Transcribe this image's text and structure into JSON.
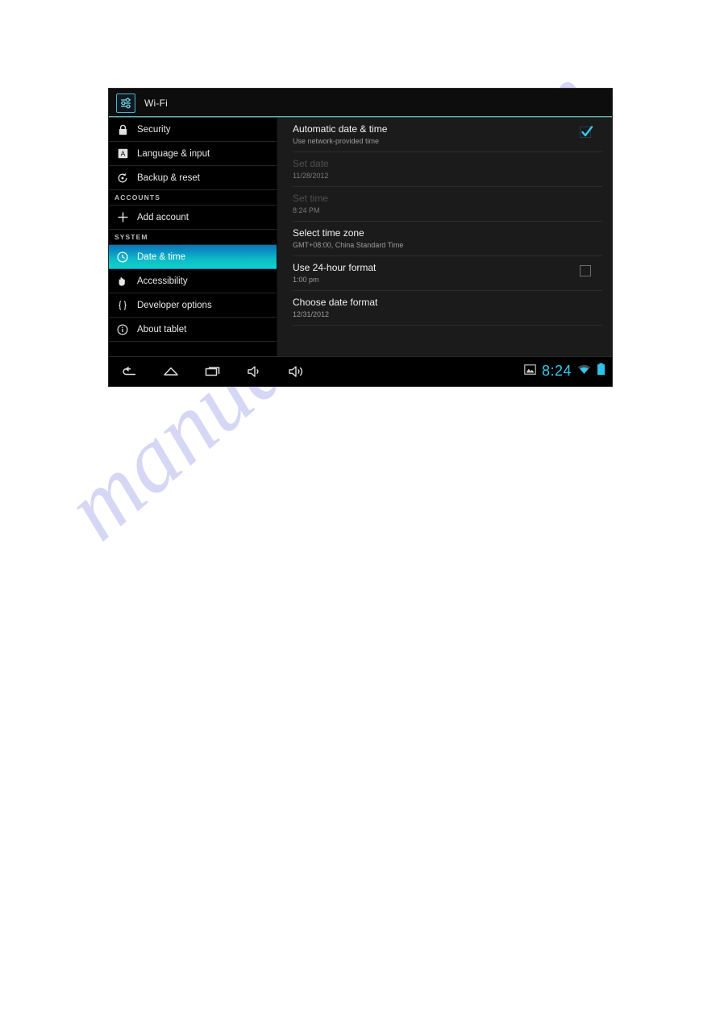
{
  "page": {
    "watermark": "manualshive.com"
  },
  "titlebar": {
    "icon": "settings-sliders-icon",
    "label": "Wi-Fi"
  },
  "sidebar": {
    "items": [
      {
        "type": "item",
        "icon": "lock-icon",
        "label": "Security",
        "selected": false
      },
      {
        "type": "item",
        "icon": "language-a-icon",
        "label": "Language & input",
        "selected": false
      },
      {
        "type": "item",
        "icon": "backup-reset-icon",
        "label": "Backup & reset",
        "selected": false
      },
      {
        "type": "section",
        "label": "ACCOUNTS"
      },
      {
        "type": "item",
        "icon": "plus-icon",
        "label": "Add account",
        "selected": false
      },
      {
        "type": "section",
        "label": "SYSTEM"
      },
      {
        "type": "item",
        "icon": "clock-icon",
        "label": "Date & time",
        "selected": true
      },
      {
        "type": "item",
        "icon": "hand-accessibility-icon",
        "label": "Accessibility",
        "selected": false
      },
      {
        "type": "item",
        "icon": "curly-braces-icon",
        "label": "Developer options",
        "selected": false
      },
      {
        "type": "item",
        "icon": "info-circle-icon",
        "label": "About tablet",
        "selected": false
      }
    ]
  },
  "panel": {
    "prefs": [
      {
        "title": "Automatic date & time",
        "sub": "Use network-provided time",
        "control": "checkbox",
        "checked": true,
        "disabled": false
      },
      {
        "title": "Set date",
        "sub": "11/28/2012",
        "control": "none",
        "checked": false,
        "disabled": true
      },
      {
        "title": "Set time",
        "sub": "8:24 PM",
        "control": "none",
        "checked": false,
        "disabled": true
      },
      {
        "title": "Select time zone",
        "sub": "GMT+08:00, China Standard Time",
        "control": "none",
        "checked": false,
        "disabled": false
      },
      {
        "title": "Use 24-hour format",
        "sub": "1:00 pm",
        "control": "checkbox",
        "checked": false,
        "disabled": false
      },
      {
        "title": "Choose date format",
        "sub": "12/31/2012",
        "control": "none",
        "checked": false,
        "disabled": false
      }
    ]
  },
  "systembar": {
    "navkeys": [
      {
        "icon": "back-icon",
        "label": "Back"
      },
      {
        "icon": "home-icon",
        "label": "Home"
      },
      {
        "icon": "recents-icon",
        "label": "Recent apps"
      },
      {
        "icon": "volume-down-icon",
        "label": "Volume down"
      },
      {
        "icon": "volume-up-icon",
        "label": "Volume up"
      }
    ],
    "status": {
      "screenshot_icon": "image-icon",
      "clock": "8:24",
      "wifi_icon": "wifi-icon",
      "battery_icon": "battery-icon"
    }
  },
  "colors": {
    "accent_top": "#0b74b8",
    "accent_bottom": "#10d2cc",
    "clock": "#38c8e8",
    "battery": "#2ec2e8",
    "panel_bg": "#1b1b1b",
    "sidebar_bg": "#000000",
    "watermark": "#c9c9f2"
  }
}
